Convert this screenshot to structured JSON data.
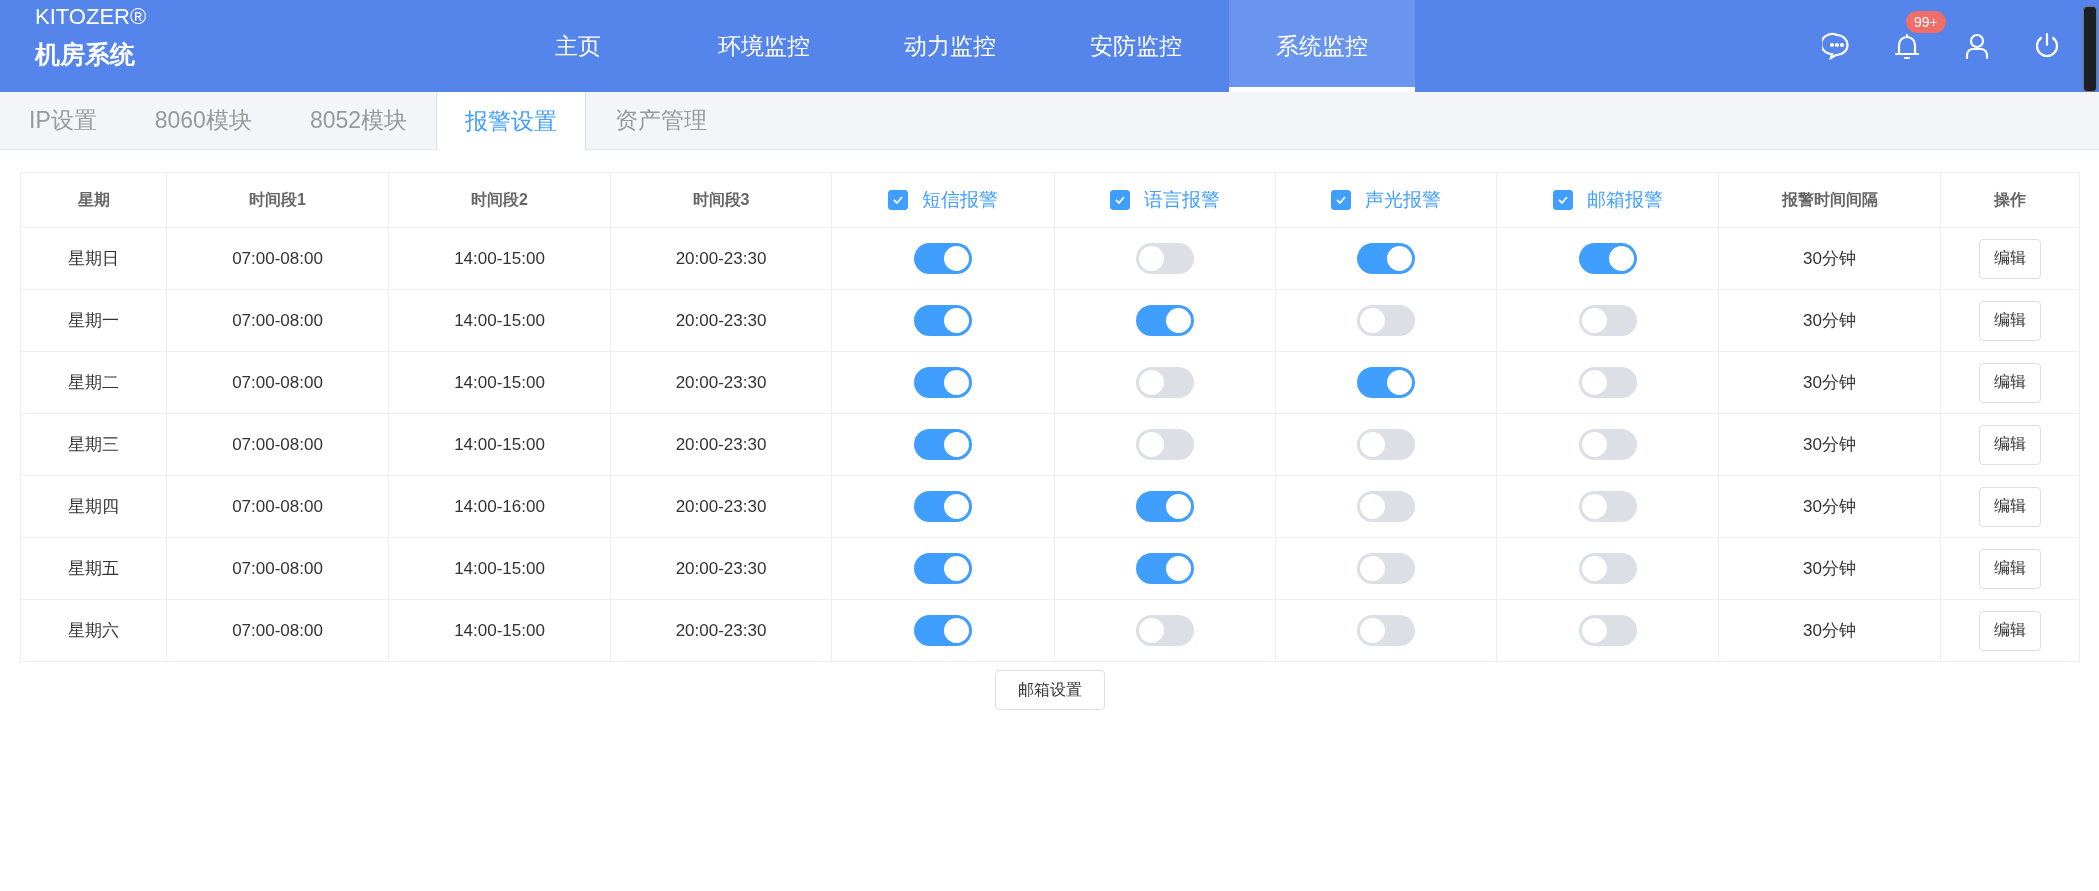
{
  "header": {
    "brand": "KITOZER®",
    "system_name": "机房系统",
    "nav": [
      {
        "label": "主页",
        "selected": false
      },
      {
        "label": "环境监控",
        "selected": false
      },
      {
        "label": "动力监控",
        "selected": false
      },
      {
        "label": "安防监控",
        "selected": false
      },
      {
        "label": "系统监控",
        "selected": true
      }
    ],
    "notification_badge": "99+"
  },
  "tabs": [
    {
      "label": "IP设置",
      "selected": false
    },
    {
      "label": "8060模块",
      "selected": false
    },
    {
      "label": "8052模块",
      "selected": false
    },
    {
      "label": "报警设置",
      "selected": true
    },
    {
      "label": "资产管理",
      "selected": false
    }
  ],
  "table": {
    "columns": [
      {
        "kind": "text",
        "label": "星期"
      },
      {
        "kind": "text",
        "label": "时间段1"
      },
      {
        "kind": "text",
        "label": "时间段2"
      },
      {
        "kind": "text",
        "label": "时间段3"
      },
      {
        "kind": "checkbox",
        "label": "短信报警",
        "checked": true
      },
      {
        "kind": "checkbox",
        "label": "语言报警",
        "checked": true
      },
      {
        "kind": "checkbox",
        "label": "声光报警",
        "checked": true
      },
      {
        "kind": "checkbox",
        "label": "邮箱报警",
        "checked": true
      },
      {
        "kind": "text",
        "label": "报警时间间隔"
      },
      {
        "kind": "text",
        "label": "操作"
      }
    ],
    "rows": [
      {
        "day": "星期日",
        "times": [
          "07:00-08:00",
          "14:00-15:00",
          "20:00-23:30"
        ],
        "switches": [
          {
            "on": true
          },
          {
            "on": false
          },
          {
            "on": true
          },
          {
            "on": true
          }
        ],
        "interval": "30分钟",
        "action": "编辑"
      },
      {
        "day": "星期一",
        "times": [
          "07:00-08:00",
          "14:00-15:00",
          "20:00-23:30"
        ],
        "switches": [
          {
            "on": true
          },
          {
            "on": true
          },
          {
            "on": false
          },
          {
            "on": false
          }
        ],
        "interval": "30分钟",
        "action": "编辑"
      },
      {
        "day": "星期二",
        "times": [
          "07:00-08:00",
          "14:00-15:00",
          "20:00-23:30"
        ],
        "switches": [
          {
            "on": true
          },
          {
            "on": false
          },
          {
            "on": true
          },
          {
            "on": false
          }
        ],
        "interval": "30分钟",
        "action": "编辑"
      },
      {
        "day": "星期三",
        "times": [
          "07:00-08:00",
          "14:00-15:00",
          "20:00-23:30"
        ],
        "switches": [
          {
            "on": true
          },
          {
            "on": false
          },
          {
            "on": false
          },
          {
            "on": false
          }
        ],
        "interval": "30分钟",
        "action": "编辑"
      },
      {
        "day": "星期四",
        "times": [
          "07:00-08:00",
          "14:00-16:00",
          "20:00-23:30"
        ],
        "switches": [
          {
            "on": true
          },
          {
            "on": true
          },
          {
            "on": false
          },
          {
            "on": false
          }
        ],
        "interval": "30分钟",
        "action": "编辑"
      },
      {
        "day": "星期五",
        "times": [
          "07:00-08:00",
          "14:00-15:00",
          "20:00-23:30"
        ],
        "switches": [
          {
            "on": true
          },
          {
            "on": true
          },
          {
            "on": false
          },
          {
            "on": false
          }
        ],
        "interval": "30分钟",
        "action": "编辑"
      },
      {
        "day": "星期六",
        "times": [
          "07:00-08:00",
          "14:00-15:00",
          "20:00-23:30"
        ],
        "switches": [
          {
            "on": true
          },
          {
            "on": false
          },
          {
            "on": false
          },
          {
            "on": false
          }
        ],
        "interval": "30分钟",
        "action": "编辑"
      }
    ]
  },
  "footer_button": "邮箱设置"
}
